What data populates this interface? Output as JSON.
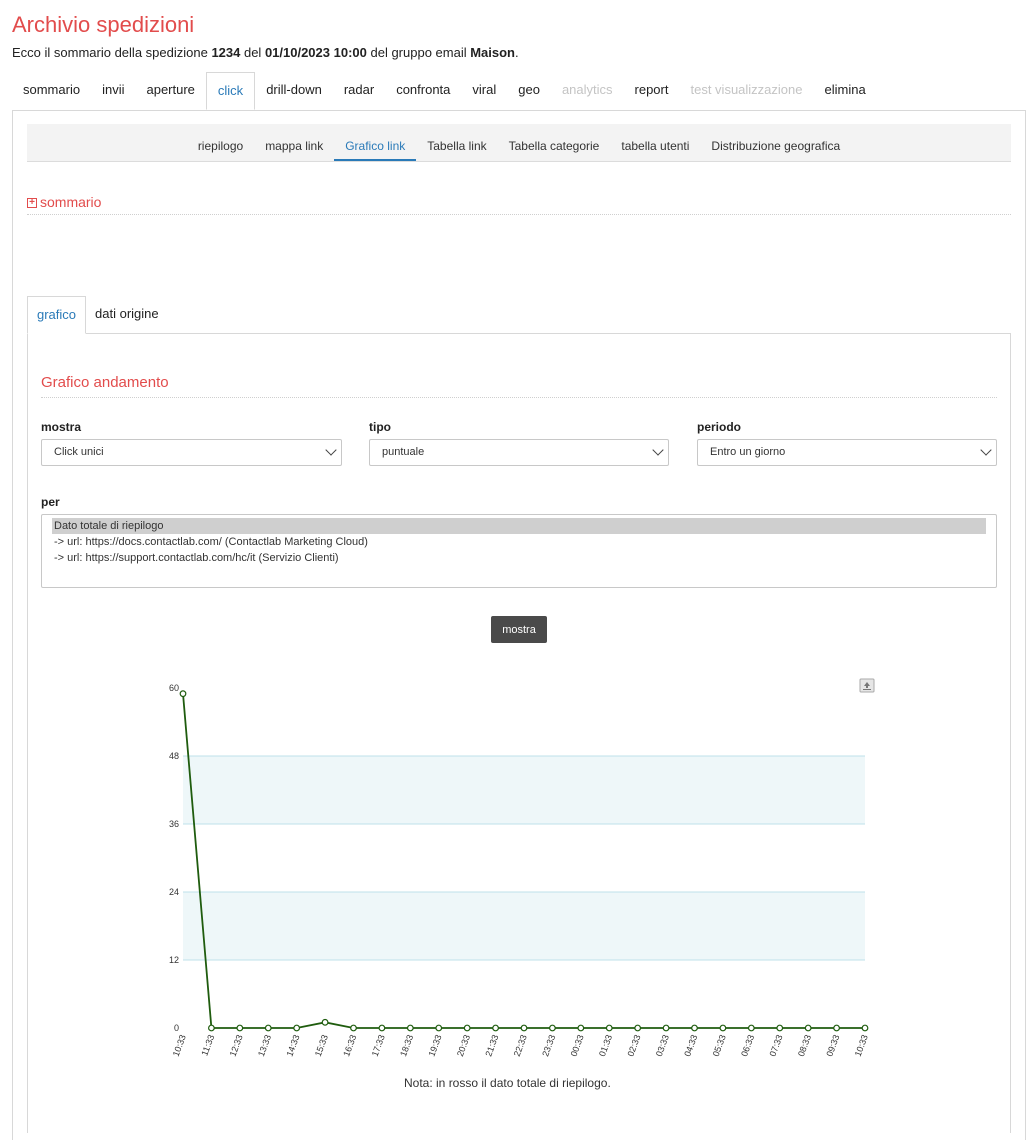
{
  "header": {
    "title": "Archivio spedizioni",
    "subtitle_prefix": "Ecco il sommario della spedizione ",
    "delivery_id": "1234",
    "subtitle_del": " del ",
    "date": "01/10/2023 10:00",
    "subtitle_group": " del gruppo email ",
    "group": "Maison",
    "subtitle_end": "."
  },
  "main_tabs": [
    {
      "label": "sommario",
      "state": "normal"
    },
    {
      "label": "invii",
      "state": "normal"
    },
    {
      "label": "aperture",
      "state": "normal"
    },
    {
      "label": "click",
      "state": "active"
    },
    {
      "label": "drill-down",
      "state": "normal"
    },
    {
      "label": "radar",
      "state": "normal"
    },
    {
      "label": "confronta",
      "state": "normal"
    },
    {
      "label": "viral",
      "state": "normal"
    },
    {
      "label": "geo",
      "state": "normal"
    },
    {
      "label": "analytics",
      "state": "disabled"
    },
    {
      "label": "report",
      "state": "normal"
    },
    {
      "label": "test visualizzazione",
      "state": "disabled"
    },
    {
      "label": "elimina",
      "state": "normal"
    }
  ],
  "sub_tabs": [
    {
      "label": "riepilogo",
      "active": false
    },
    {
      "label": "mappa link",
      "active": false
    },
    {
      "label": "Grafico link",
      "active": true
    },
    {
      "label": "Tabella link",
      "active": false
    },
    {
      "label": "Tabella categorie",
      "active": false
    },
    {
      "label": "tabella utenti",
      "active": false
    },
    {
      "label": "Distribuzione geografica",
      "active": false
    }
  ],
  "summary_section": {
    "icon": "plus-square-icon",
    "label": "sommario"
  },
  "inner_tabs": [
    {
      "label": "grafico",
      "active": true
    },
    {
      "label": "dati origine",
      "active": false
    }
  ],
  "section_title": "Grafico andamento",
  "filters": {
    "mostra": {
      "label": "mostra",
      "value": "Click unici"
    },
    "tipo": {
      "label": "tipo",
      "value": "puntuale"
    },
    "periodo": {
      "label": "periodo",
      "value": "Entro un giorno"
    }
  },
  "per": {
    "label": "per",
    "options": [
      {
        "text": "Dato totale di riepilogo",
        "selected": true
      },
      {
        "text": "-> url: https://docs.contactlab.com/ (Contactlab Marketing Cloud)",
        "selected": false
      },
      {
        "text": "-> url: https://support.contactlab.com/hc/it (Servizio Clienti)",
        "selected": false
      }
    ]
  },
  "show_button": "mostra",
  "export_icon": "export-icon",
  "colors": {
    "accent": "#e24c4c",
    "link": "#2a7ab8",
    "line": "#1f5c0e",
    "band": "#eef7f9",
    "grid": "#bfe0ea"
  },
  "chart_data": {
    "type": "line",
    "x": [
      "10:33",
      "11:33",
      "12:33",
      "13:33",
      "14:33",
      "15:33",
      "16:33",
      "17:33",
      "18:33",
      "19:33",
      "20:33",
      "21:33",
      "22:33",
      "23:33",
      "00:33",
      "01:33",
      "02:33",
      "03:33",
      "04:33",
      "05:33",
      "06:33",
      "07:33",
      "08:33",
      "09:33",
      "10:33"
    ],
    "series": [
      {
        "values": [
          59,
          0,
          0,
          0,
          0,
          1,
          0,
          0,
          0,
          0,
          0,
          0,
          0,
          0,
          0,
          0,
          0,
          0,
          0,
          0,
          0,
          0,
          0,
          0,
          0
        ]
      }
    ],
    "yticks": [
      0,
      12,
      24,
      36,
      48,
      60
    ],
    "ylim": [
      0,
      60
    ],
    "grid": true,
    "legend": "none"
  },
  "note": "Nota: in rosso il dato totale di riepilogo."
}
